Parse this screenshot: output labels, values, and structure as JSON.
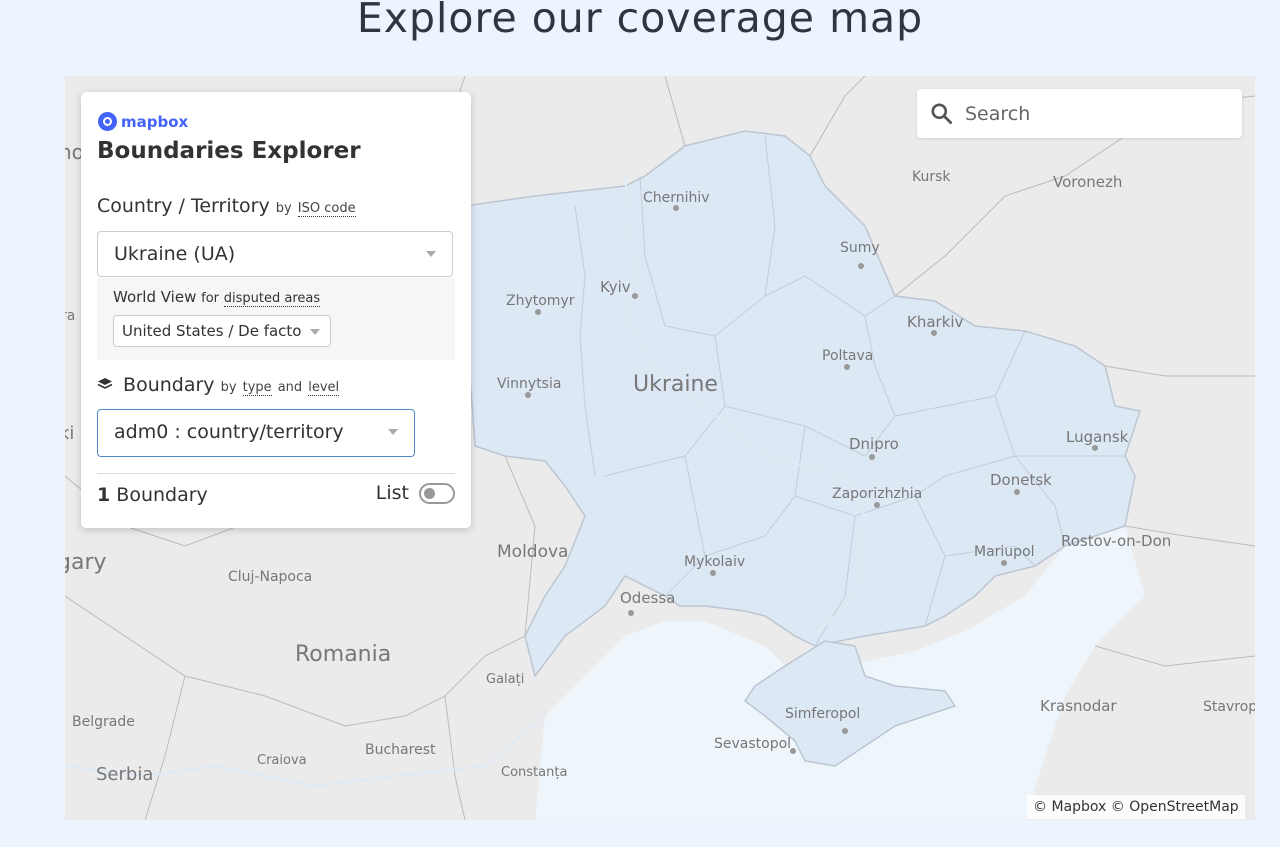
{
  "page": {
    "title": "Explore our coverage map"
  },
  "search": {
    "placeholder": "Search"
  },
  "panel": {
    "brand": "mapbox",
    "title": "Boundaries Explorer",
    "country_label": "Country / Territory",
    "country_by": "by",
    "country_by_link": "ISO code",
    "country_value": "Ukraine (UA)",
    "worldview_label": "World View",
    "worldview_for": "for",
    "worldview_link": "disputed areas",
    "worldview_value": "United States / De facto",
    "boundary_label": "Boundary",
    "boundary_by": "by",
    "boundary_type": "type",
    "boundary_and": "and",
    "boundary_level": "level",
    "boundary_value": "adm0 : country/territory",
    "count_number": "1",
    "count_label": "Boundary",
    "list_label": "List",
    "list_enabled": false
  },
  "map": {
    "country_name": "Ukraine",
    "highlight_color": "#dde8f5",
    "cities": [
      "Chernihiv",
      "Kursk",
      "Voronezh",
      "Sumy",
      "Kyiv",
      "Zhytomyr",
      "Kharkiv",
      "Poltava",
      "Vinnytsia",
      "Dnipro",
      "Lugansk",
      "Donetsk",
      "Zaporizhzhia",
      "Mariupol",
      "Rostov-on-Don",
      "Mykolaiv",
      "Odessa",
      "Krasnodar",
      "Stavrop",
      "Simferopol",
      "Sevastopol",
      "Cluj-Napoca",
      "Galați",
      "Belgrade",
      "Bucharest",
      "Craiova",
      "Constanța"
    ],
    "countries": [
      "Moldova",
      "Romania",
      "Serbia",
      "gary",
      "no",
      "ra",
      "ki"
    ],
    "attribution": "© Mapbox © OpenStreetMap"
  }
}
